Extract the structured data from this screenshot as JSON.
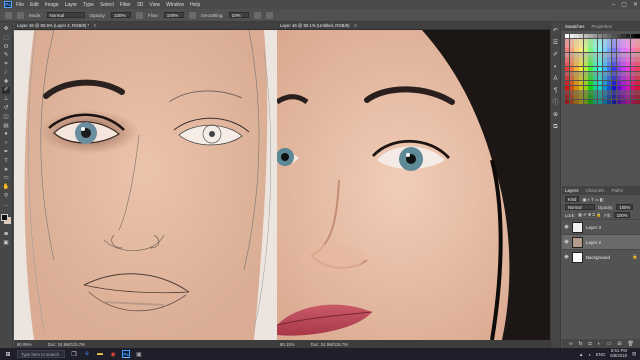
{
  "app": {
    "logo": "Ps",
    "menu": [
      "File",
      "Edit",
      "Image",
      "Layer",
      "Type",
      "Select",
      "Filter",
      "3D",
      "View",
      "Window",
      "Help"
    ]
  },
  "options": {
    "mode_label": "Mode:",
    "mode_value": "Normal",
    "opacity_label": "Opacity:",
    "opacity_value": "100%",
    "flow_label": "Flow:",
    "flow_value": "100%",
    "smoothing_label": "Smoothing:",
    "smoothing_value": "10%"
  },
  "documents": [
    {
      "title": "Layer 46 @ 80.9% (Layer 2, RGB/8) *",
      "zoom": "80.95%",
      "doc_size": "Doc: 24.9M/115.7M"
    },
    {
      "title": "Layer 46 @ 80.1% (Untitled, RGB/8)",
      "zoom": "80.15%",
      "doc_size": "Doc: 24.9M/115.7M"
    }
  ],
  "panels": {
    "swatches_tabs": [
      "Swatches",
      "Properties"
    ],
    "layers_tabs": [
      "Layers",
      "Channels",
      "Paths"
    ],
    "kind_label": "Kind",
    "blend_mode": "Normal",
    "opacity_label": "Opacity:",
    "opacity_value": "100%",
    "lock_label": "Lock:",
    "fill_label": "Fill:",
    "fill_value": "100%",
    "layers": [
      {
        "name": "Layer 3",
        "selected": false
      },
      {
        "name": "Layer 2",
        "selected": true
      },
      {
        "name": "Background",
        "selected": false
      }
    ]
  },
  "taskbar": {
    "search_placeholder": "Type here to search",
    "lang": "ENG",
    "time": "6:51 PM",
    "date": "6/8/2018"
  },
  "colors": {
    "foreground": "#111111",
    "background": "#e8c9b4",
    "skin": "#e6bea8",
    "accent": "#3fa0ff"
  }
}
